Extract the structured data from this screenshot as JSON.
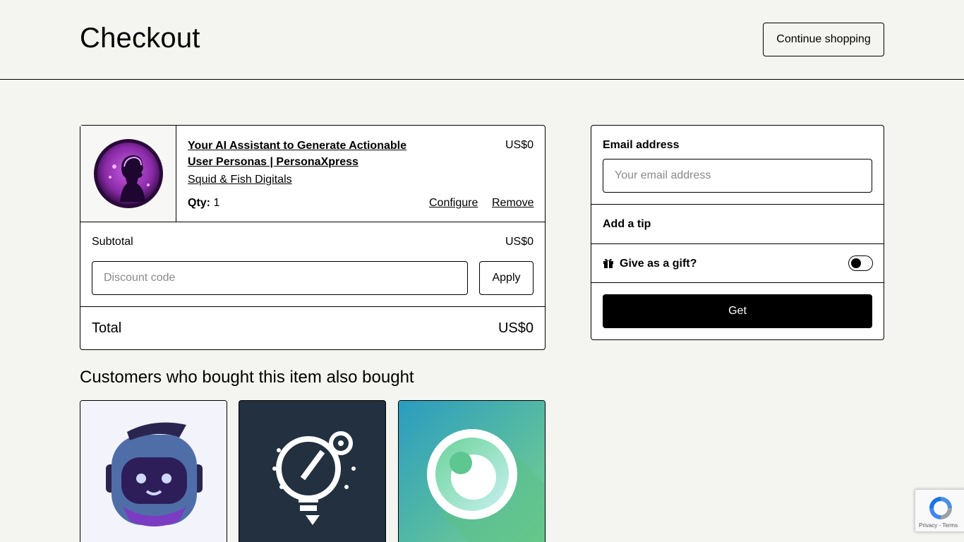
{
  "header": {
    "title": "Checkout",
    "continue_label": "Continue shopping"
  },
  "cart": {
    "item": {
      "image_icon": "persona-avatar-icon",
      "title": "Your AI Assistant to Generate Actionable User Personas | PersonaXpress",
      "price": "US$0",
      "seller": "Squid & Fish Digitals",
      "qty_label": "Qty:",
      "qty_value": "1",
      "configure_label": "Configure",
      "remove_label": "Remove"
    },
    "subtotal_label": "Subtotal",
    "subtotal_value": "US$0",
    "discount_placeholder": "Discount code",
    "apply_label": "Apply",
    "total_label": "Total",
    "total_value": "US$0"
  },
  "side": {
    "email_label": "Email address",
    "email_placeholder": "Your email address",
    "tip_label": "Add a tip",
    "gift_icon": "gift-icon",
    "gift_label": "Give as a gift?",
    "gift_enabled": false,
    "get_label": "Get"
  },
  "recommendations": {
    "title": "Customers who bought this item also bought",
    "items": [
      {
        "icon": "robot-mascot-icon"
      },
      {
        "icon": "lightbulb-icon"
      },
      {
        "icon": "eye-icon"
      }
    ]
  },
  "recaptcha": {
    "text": "Privacy - Terms"
  }
}
